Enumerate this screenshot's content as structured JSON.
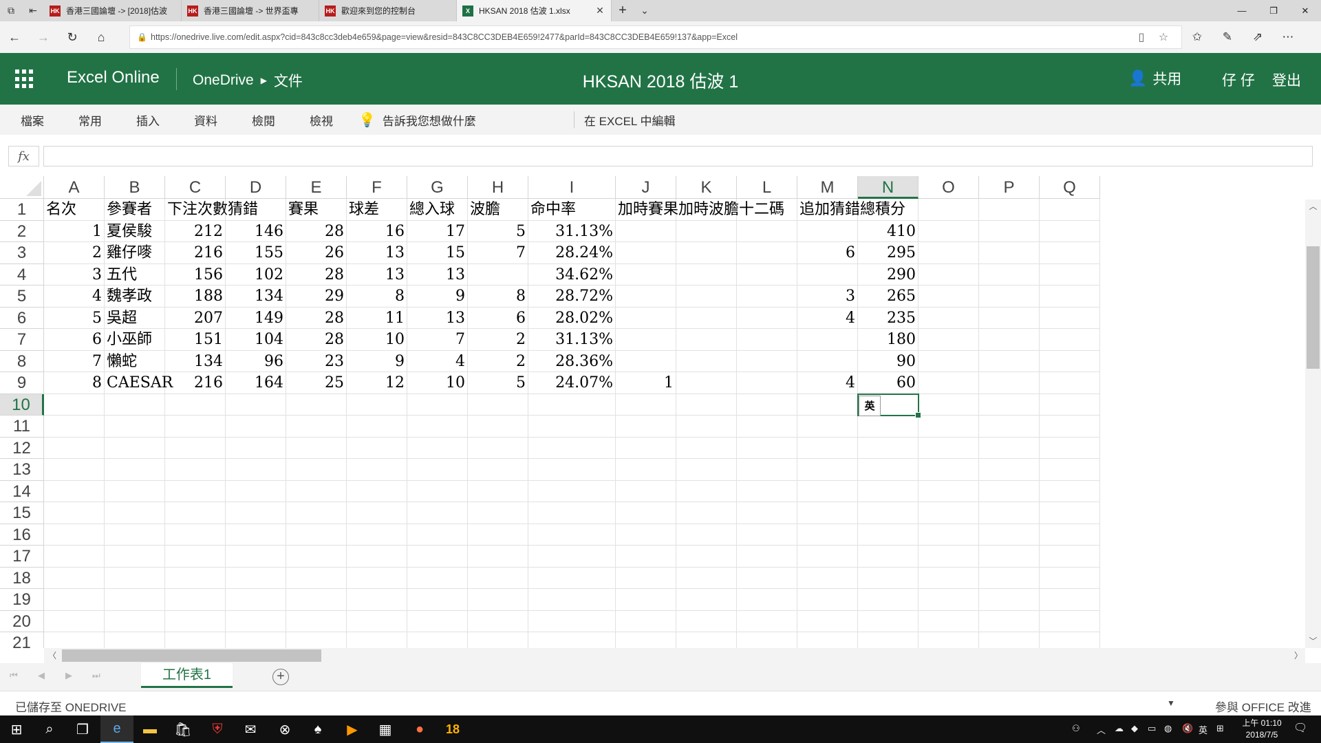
{
  "browser": {
    "tabs": [
      {
        "title": "香港三國論壇 -> [2018]估波",
        "favicon": "HK"
      },
      {
        "title": "香港三國論壇 -> 世界盃專",
        "favicon": "HK"
      },
      {
        "title": "歡迎來到您的控制台",
        "favicon": "HK"
      },
      {
        "title": "HKSAN 2018 估波 1.xlsx",
        "favicon": "X"
      }
    ],
    "new_tab": "+",
    "tab_close": "✕",
    "url": "https://onedrive.live.com/edit.aspx?cid=843c8cc3deb4e659&page=view&resid=843C8CC3DEB4E659!2477&parId=843C8CC3DEB4E659!137&app=Excel"
  },
  "app": {
    "name": "Excel Online",
    "breadcrumb": [
      "OneDrive",
      "文件"
    ],
    "doc_title": "HKSAN 2018 估波 1",
    "share_label": "共用",
    "user_name": "仔 仔",
    "sign_out": "登出"
  },
  "ribbon": {
    "tabs": [
      "檔案",
      "常用",
      "插入",
      "資料",
      "檢閱",
      "檢視"
    ],
    "tell_me": "告訴我您想做什麼",
    "edit_in_excel": "在 EXCEL 中編輯"
  },
  "formula_bar": {
    "fx": "fx",
    "value": ""
  },
  "sheet": {
    "columns": [
      "A",
      "B",
      "C",
      "D",
      "E",
      "F",
      "G",
      "H",
      "I",
      "J",
      "K",
      "L",
      "M",
      "N",
      "O",
      "P",
      "Q"
    ],
    "row_numbers": [
      "1",
      "2",
      "3",
      "4",
      "5",
      "6",
      "7",
      "8",
      "9",
      "10",
      "11",
      "12",
      "13",
      "14",
      "15",
      "16",
      "17",
      "18",
      "19",
      "20",
      "21"
    ],
    "selected_column": "N",
    "selected_row": "10",
    "header_row": [
      "名次",
      "參賽者",
      "下注次數",
      "猜錯",
      "賽果",
      "球差",
      "總入球",
      "波膽",
      "命中率",
      "加時賽果",
      "加時波膽",
      "十二碼",
      "追加猜錯",
      "總積分"
    ],
    "rows": [
      [
        "1",
        "夏侯駿",
        "212",
        "146",
        "28",
        "16",
        "17",
        "5",
        "31.13%",
        "",
        "",
        "",
        "",
        "410"
      ],
      [
        "2",
        "雞仔嘜",
        "216",
        "155",
        "26",
        "13",
        "15",
        "7",
        "28.24%",
        "",
        "",
        "",
        "6",
        "295"
      ],
      [
        "3",
        "五代",
        "156",
        "102",
        "28",
        "13",
        "13",
        "",
        "34.62%",
        "",
        "",
        "",
        "",
        "290"
      ],
      [
        "4",
        "魏孝政",
        "188",
        "134",
        "29",
        "8",
        "9",
        "8",
        "28.72%",
        "",
        "",
        "",
        "3",
        "265"
      ],
      [
        "5",
        "吳超",
        "207",
        "149",
        "28",
        "11",
        "13",
        "6",
        "28.02%",
        "",
        "",
        "",
        "4",
        "235"
      ],
      [
        "6",
        "小巫師",
        "151",
        "104",
        "28",
        "10",
        "7",
        "2",
        "31.13%",
        "",
        "",
        "",
        "",
        "180"
      ],
      [
        "7",
        "懶蛇",
        "134",
        "96",
        "23",
        "9",
        "4",
        "2",
        "28.36%",
        "",
        "",
        "",
        "",
        "90"
      ],
      [
        "8",
        "CAESAR",
        "216",
        "164",
        "25",
        "12",
        "10",
        "5",
        "24.07%",
        "1",
        "",
        "",
        "4",
        "60"
      ]
    ],
    "ime_indicator": "英",
    "sheet_tab": "工作表1"
  },
  "status": {
    "saved": "已儲存至 ONEDRIVE",
    "feedback": "參與 OFFICE 改進"
  },
  "taskbar": {
    "badge_count": "18",
    "clock_time": "上午 01:10",
    "clock_date": "2018/7/5",
    "ime": "英"
  },
  "colors": {
    "excel_green": "#217346",
    "hk_red": "#b71c1c"
  }
}
